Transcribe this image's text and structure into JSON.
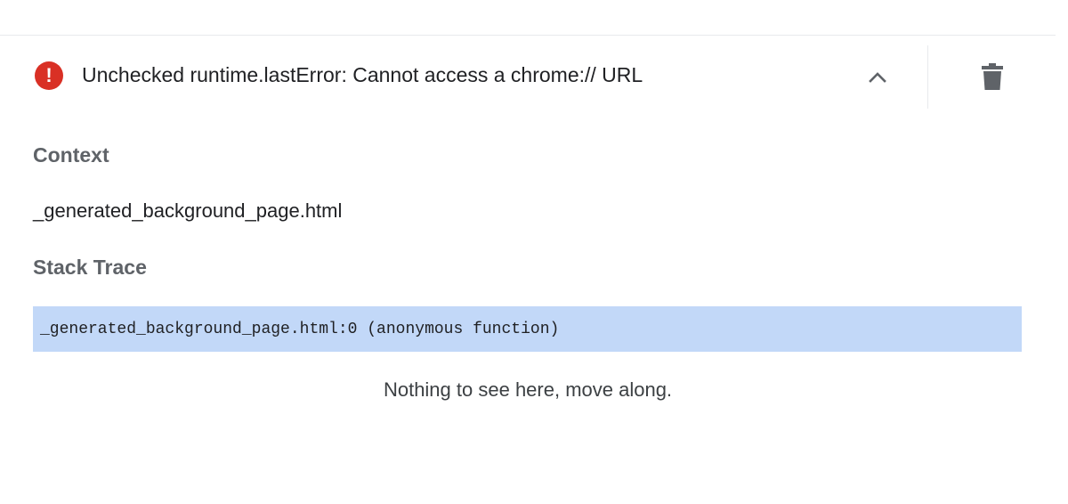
{
  "error": {
    "icon": "error-circle-icon",
    "message": "Unchecked runtime.lastError: Cannot access a chrome:// URL",
    "collapse_icon": "chevron-up-icon",
    "delete_icon": "trash-icon"
  },
  "context": {
    "heading": "Context",
    "value": "_generated_background_page.html"
  },
  "stack_trace": {
    "heading": "Stack Trace",
    "frames": [
      {
        "text": "_generated_background_page.html:0 (anonymous function)"
      }
    ]
  },
  "code_view": {
    "empty_message": "Nothing to see here, move along."
  },
  "colors": {
    "error": "#d93025",
    "selected_frame": "#c2d8f8",
    "heading": "#5f6368",
    "icon": "#5f6368"
  }
}
